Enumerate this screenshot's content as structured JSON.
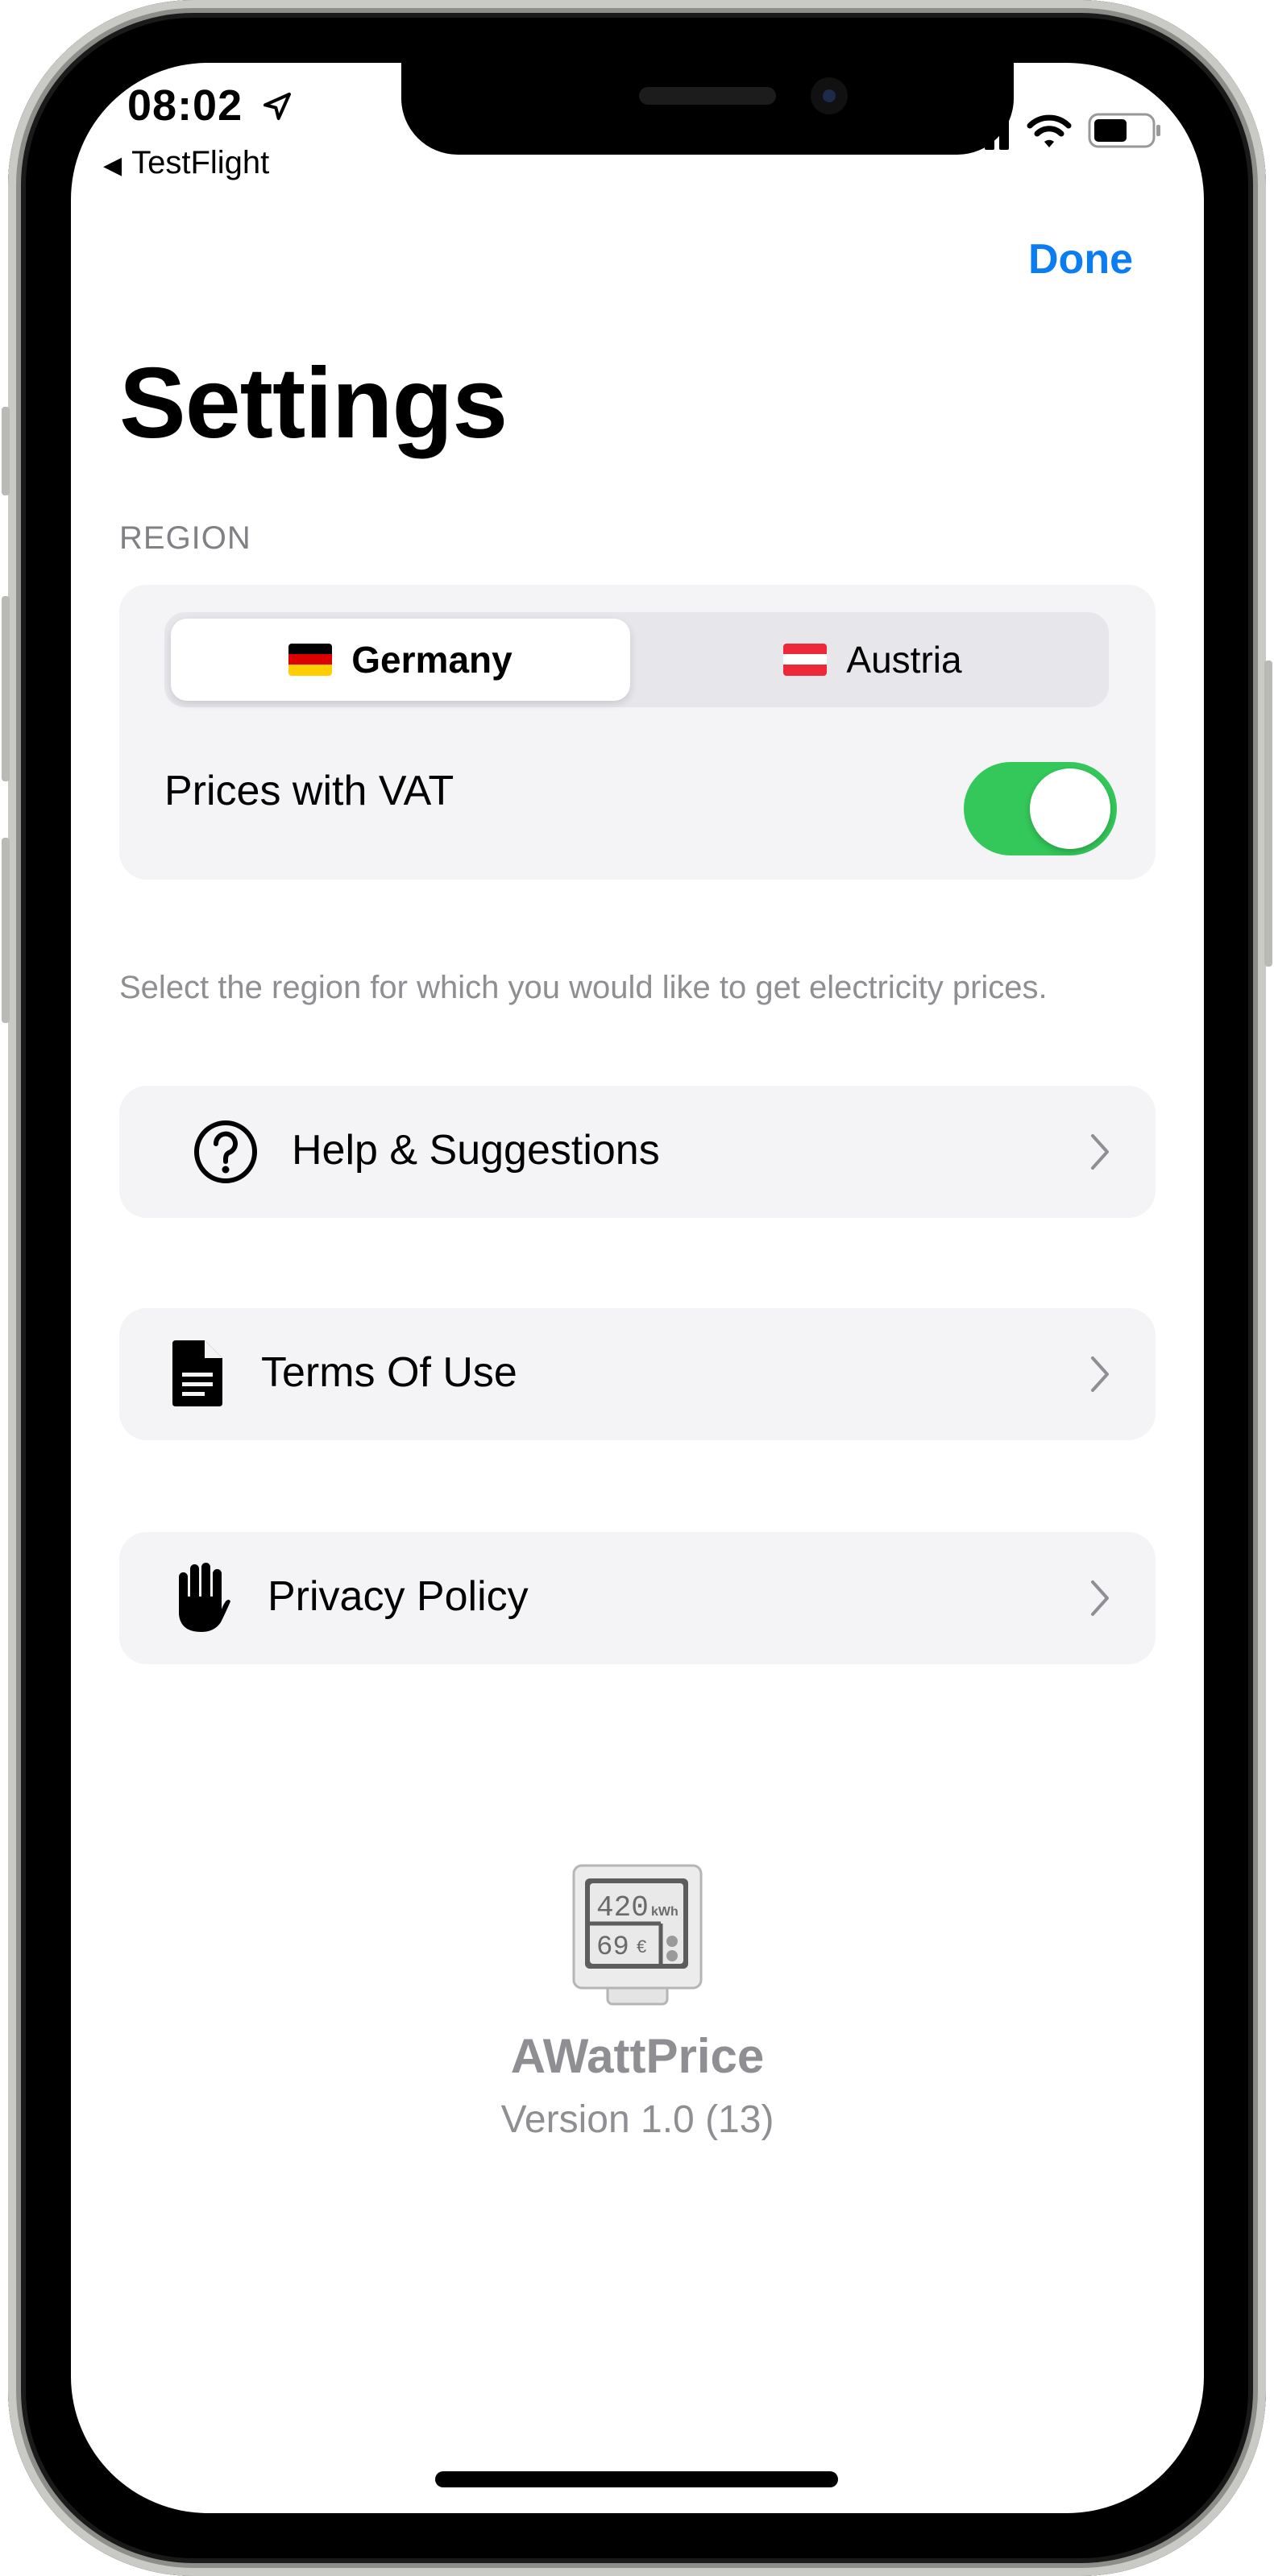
{
  "status_bar": {
    "time": "08:02",
    "back_app": "TestFlight",
    "icons": [
      "location-arrow-icon",
      "cellular-signal-icon",
      "wifi-icon",
      "battery-icon"
    ]
  },
  "nav": {
    "done_label": "Done"
  },
  "page": {
    "title": "Settings"
  },
  "region": {
    "header": "REGION",
    "options": [
      {
        "label": "Germany",
        "flag": "germany-flag-icon",
        "selected": true
      },
      {
        "label": "Austria",
        "flag": "austria-flag-icon",
        "selected": false
      }
    ],
    "vat_label": "Prices with VAT",
    "vat_enabled": true,
    "footer": "Select the region for which you would like to get electricity prices."
  },
  "links": [
    {
      "label": "Help & Suggestions",
      "icon": "question-circle-icon"
    },
    {
      "label": "Terms Of Use",
      "icon": "document-icon"
    },
    {
      "label": "Privacy Policy",
      "icon": "hand-raised-icon"
    }
  ],
  "app_info": {
    "name": "AWattPrice",
    "version": "Version 1.0 (13)",
    "meter_top": "420",
    "meter_top_unit": "kWh",
    "meter_bottom": "69",
    "meter_bottom_unit": "€"
  },
  "colors": {
    "accent": "#0a7df2",
    "toggle_on": "#34c759",
    "card_bg": "#f4f4f7",
    "secondary_text": "#8e8e93"
  }
}
